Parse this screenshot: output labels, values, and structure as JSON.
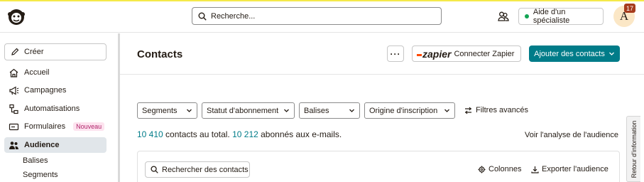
{
  "header": {
    "search_placeholder": "Recherche...",
    "help_label": "Aide d'un spécialiste",
    "avatar_initial": "A",
    "notification_count": "17",
    "colors": {
      "accent": "#007c89",
      "online": "#12a454",
      "badge": "#a63b1d",
      "topline": "#f5e94a"
    }
  },
  "sidebar": {
    "create_label": "Créer",
    "items": [
      {
        "label": "Accueil",
        "icon": "home-icon"
      },
      {
        "label": "Campagnes",
        "icon": "megaphone-icon"
      },
      {
        "label": "Automatisations",
        "icon": "flow-icon"
      },
      {
        "label": "Formulaires",
        "icon": "form-icon",
        "badge": "Nouveau"
      },
      {
        "label": "Audience",
        "icon": "audience-icon",
        "active": true
      }
    ],
    "sub_items": [
      {
        "label": "Balises"
      },
      {
        "label": "Segments"
      }
    ]
  },
  "main": {
    "title": "Contacts",
    "more_label": "···",
    "zapier_logo": "zapier",
    "zapier_label": "Connecter Zapier",
    "add_contacts_label": "Ajouter des contacts",
    "filters": [
      {
        "label": "Segments"
      },
      {
        "label": "Statut d'abonnement"
      },
      {
        "label": "Balises"
      },
      {
        "label": "Origine d'inscription"
      }
    ],
    "advanced_filters_label": "Filtres avancés",
    "summary": {
      "total_count": "10 410",
      "total_text": " contacts au total. ",
      "subscribed_count": "10 212",
      "subscribed_text": " abonnés aux e-mails."
    },
    "analysis_link": "Voir l'analyse de l'audience",
    "search_contacts_label": "Rechercher des contacts",
    "columns_label": "Colonnes",
    "export_label": "Exporter l'audience"
  },
  "feedback_tab": "Retour d'information"
}
